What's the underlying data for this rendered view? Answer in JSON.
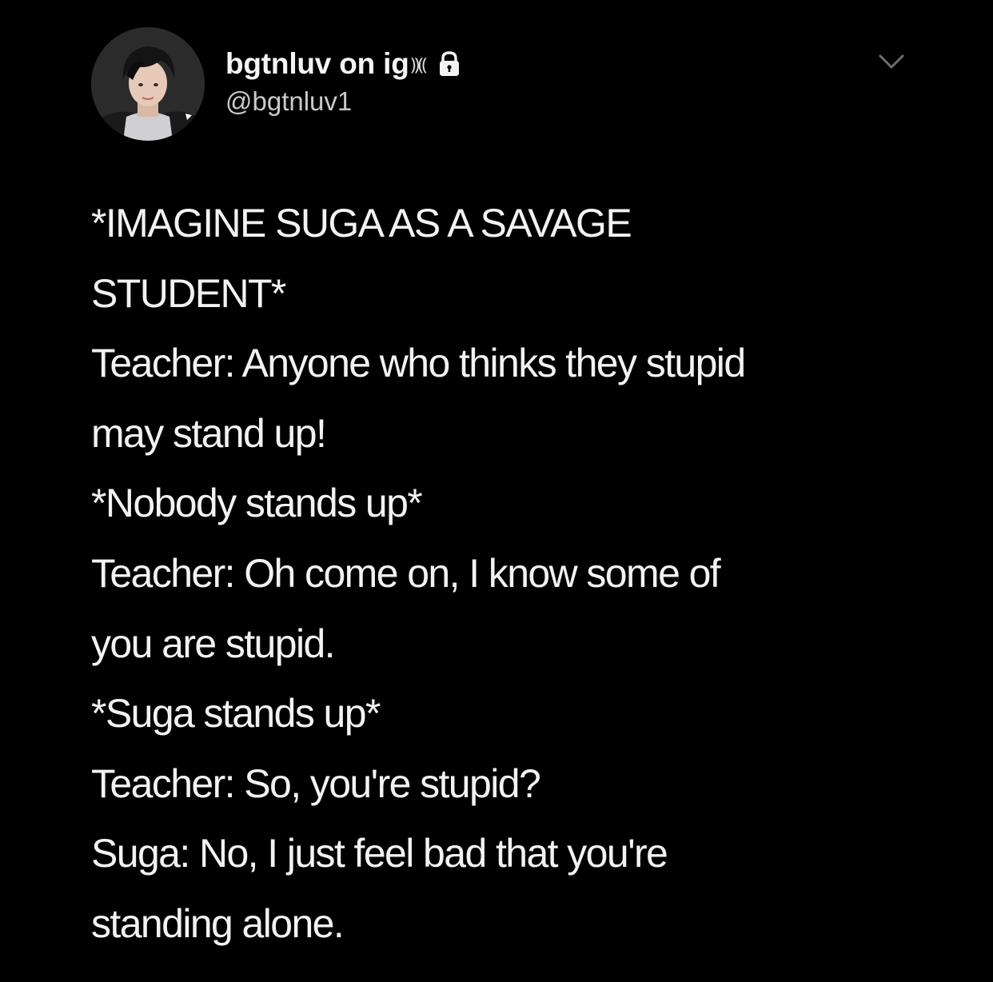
{
  "author": {
    "display_name": "bgtnluv on ig",
    "name_emoji": "⸩⸨",
    "handle": "@bgtnluv1",
    "avatar_icon": "avatar-photo",
    "lock_icon": "lock-icon",
    "menu_icon": "chevron-down-icon"
  },
  "tweet": {
    "lines": [
      "*IMAGINE SUGA AS A SAVAGE",
      "STUDENT*",
      "Teacher: Anyone who thinks they stupid",
      "may stand up!",
      "*Nobody stands up*",
      "Teacher: Oh come on, I know some of",
      "you are stupid.",
      "*Suga stands up*",
      "Teacher: So, you're stupid?",
      "Suga: No, I just feel bad that you're",
      "standing alone."
    ]
  },
  "colors": {
    "background": "#000000",
    "text": "#f2f2f2",
    "handle": "#c9c9c9",
    "chevron": "#6e6e6e"
  }
}
